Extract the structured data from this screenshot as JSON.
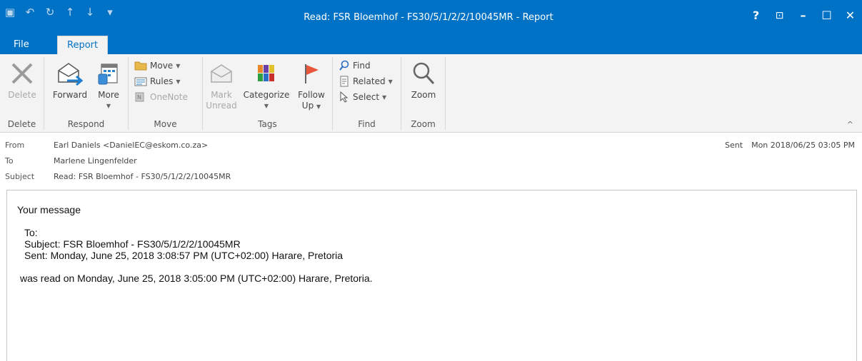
{
  "window": {
    "title": "Read: FSR Bloemhof - FS30/5/1/2/2/10045MR  - Report",
    "qat_icons": [
      "save-icon",
      "undo-icon",
      "redo-icon",
      "up-icon",
      "down-icon",
      "customize-icon"
    ],
    "qat_glyphs": [
      "▣",
      "↶",
      "↻",
      "↑",
      "↓",
      "▾"
    ],
    "controls": {
      "help": "?",
      "ribbon_options": "⊡",
      "minimize": "–",
      "maximize": "☐",
      "close": "✕"
    }
  },
  "tabs": {
    "file": "File",
    "report": "Report"
  },
  "ribbon": {
    "delete_group": {
      "label": "Delete",
      "delete": "Delete"
    },
    "respond_group": {
      "label": "Respond",
      "forward": "Forward",
      "more": "More"
    },
    "move_group": {
      "label": "Move",
      "move": "Move",
      "rules": "Rules",
      "onenote": "OneNote"
    },
    "tags_group": {
      "label": "Tags",
      "mark_unread_1": "Mark",
      "mark_unread_2": "Unread",
      "categorize": "Categorize",
      "follow_up_1": "Follow",
      "follow_up_2": "Up"
    },
    "find_group": {
      "label": "Find",
      "find": "Find",
      "related": "Related",
      "select": "Select"
    },
    "zoom_group": {
      "label": "Zoom",
      "zoom": "Zoom"
    },
    "collapse": "^"
  },
  "header": {
    "from_label": "From",
    "from_value": "Earl Daniels <DanielEC@eskom.co.za>",
    "to_label": "To",
    "to_value": "Marlene Lingenfelder",
    "subject_label": "Subject",
    "subject_value": "Read: FSR Bloemhof - FS30/5/1/2/2/10045MR",
    "sent_label": "Sent",
    "sent_value": "Mon 2018/06/25 03:05 PM"
  },
  "body": {
    "line1": "Your message",
    "to_line": "To:",
    "subject_line": "Subject: FSR Bloemhof - FS30/5/1/2/2/10045MR",
    "sent_line": "Sent: Monday, June 25, 2018 3:08:57 PM (UTC+02:00) Harare, Pretoria",
    "read_line": "was read on Monday, June 25, 2018 3:05:00 PM (UTC+02:00) Harare, Pretoria."
  },
  "colors": {
    "accent": "#0072c6",
    "ribbon_bg": "#f3f3f3",
    "flag": "#e8573c"
  }
}
